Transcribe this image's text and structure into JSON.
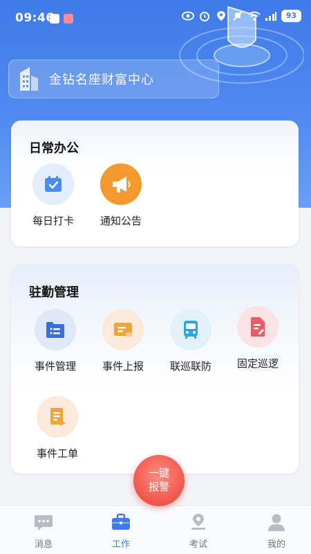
{
  "status_bar": {
    "time": "09:46",
    "battery": "93",
    "icons": [
      "eye-icon",
      "alarm-icon",
      "location-icon",
      "mute-icon",
      "wifi-icon",
      "signal-icon",
      "battery-icon"
    ]
  },
  "location": {
    "name": "金钻名座财富中心",
    "icon": "building-icon"
  },
  "daily_office": {
    "title": "日常办公",
    "items": [
      {
        "label": "每日打卡",
        "icon": "calendar-check-icon",
        "color": "#4a8cf0",
        "bg": "#e3eefc"
      },
      {
        "label": "通知公告",
        "icon": "megaphone-icon",
        "color": "#ffffff",
        "bg": "#f29a2e"
      }
    ]
  },
  "station_mgmt": {
    "title": "驻勤管理",
    "items": [
      {
        "label": "事件管理",
        "icon": "folder-list-icon",
        "color": "#3a6fd8",
        "bg": "#e0e8f8"
      },
      {
        "label": "事件上报",
        "icon": "report-card-icon",
        "color": "#f0a43a",
        "bg": "#fbeadb"
      },
      {
        "label": "联巡联防",
        "icon": "bus-icon",
        "color": "#2ba6e0",
        "bg": "#e2f1fa"
      },
      {
        "label": "固定巡逻",
        "icon": "document-edit-icon",
        "color": "#ef5a66",
        "bg": "#fbe3e5"
      },
      {
        "label": "事件工单",
        "icon": "work-order-icon",
        "color": "#f0a43a",
        "bg": "#fbeadb"
      }
    ]
  },
  "sos": {
    "line1": "一键",
    "line2": "报警"
  },
  "tabbar": {
    "tabs": [
      {
        "label": "消息",
        "icon": "chat-icon"
      },
      {
        "label": "工作",
        "icon": "briefcase-icon",
        "active": true
      },
      {
        "label": "考试",
        "icon": "exam-icon"
      },
      {
        "label": "我的",
        "icon": "user-icon"
      }
    ]
  }
}
